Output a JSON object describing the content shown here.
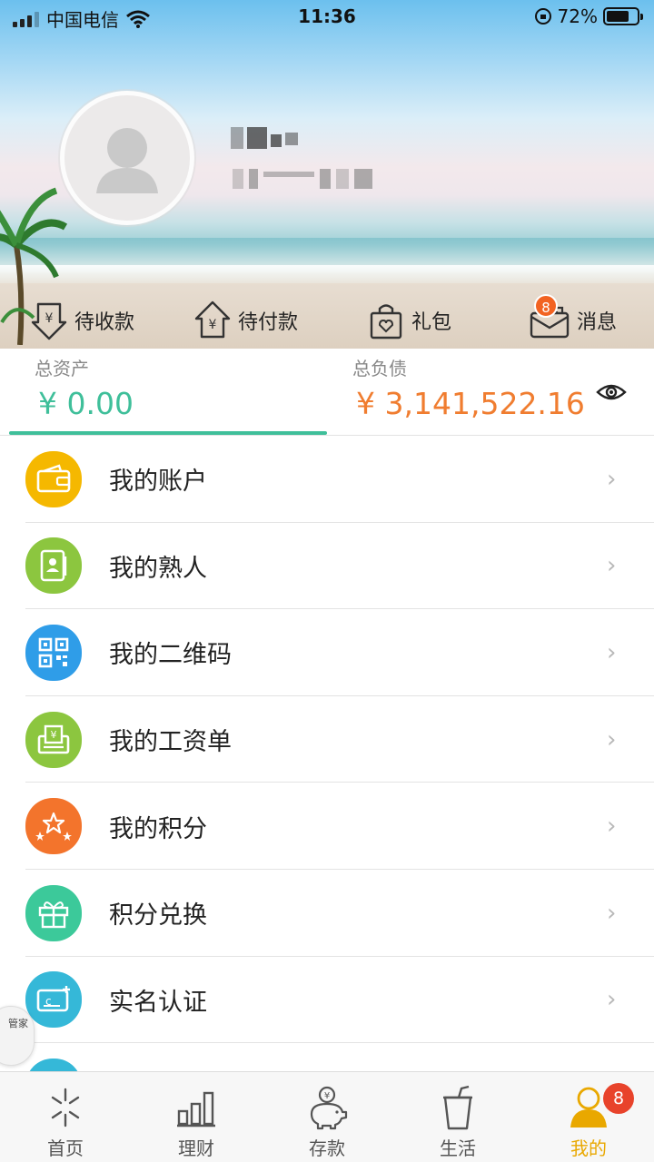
{
  "status_bar": {
    "carrier": "中国电信",
    "time": "11:36",
    "battery": "72%"
  },
  "quick_actions": [
    {
      "label": "待收款",
      "icon": "receive-yen-icon"
    },
    {
      "label": "待付款",
      "icon": "pay-yen-icon"
    },
    {
      "label": "礼包",
      "icon": "gift-bag-icon"
    },
    {
      "label": "消息",
      "icon": "message-icon",
      "badge": "8"
    }
  ],
  "balance": {
    "assets_label": "总资产",
    "assets_value": "¥ 0.00",
    "debt_label": "总负债",
    "debt_value": "¥ 3,141,522.16"
  },
  "menu": [
    {
      "label": "我的账户",
      "icon": "wallet-icon",
      "color": "#f5b800"
    },
    {
      "label": "我的熟人",
      "icon": "contacts-icon",
      "color": "#8cc63f"
    },
    {
      "label": "我的二维码",
      "icon": "qr-code-icon",
      "color": "#2f9de8"
    },
    {
      "label": "我的工资单",
      "icon": "payslip-icon",
      "color": "#8cc63f"
    },
    {
      "label": "我的积分",
      "icon": "stars-icon",
      "color": "#f3742c"
    },
    {
      "label": "积分兑换",
      "icon": "gift-box-icon",
      "color": "#3cc99a"
    },
    {
      "label": "实名认证",
      "icon": "id-card-icon",
      "color": "#35b8d8"
    }
  ],
  "floating_helper": "管家",
  "tabs": [
    {
      "label": "首页",
      "icon": "home-icon"
    },
    {
      "label": "理财",
      "icon": "chart-icon"
    },
    {
      "label": "存款",
      "icon": "piggy-bank-icon"
    },
    {
      "label": "生活",
      "icon": "cup-icon"
    },
    {
      "label": "我的",
      "icon": "profile-icon",
      "badge": "8",
      "active": true
    }
  ],
  "colors": {
    "accent_green": "#3fbf9a",
    "debt_orange": "#f07d30",
    "tab_active": "#e9a800",
    "badge_red": "#e8432b"
  }
}
